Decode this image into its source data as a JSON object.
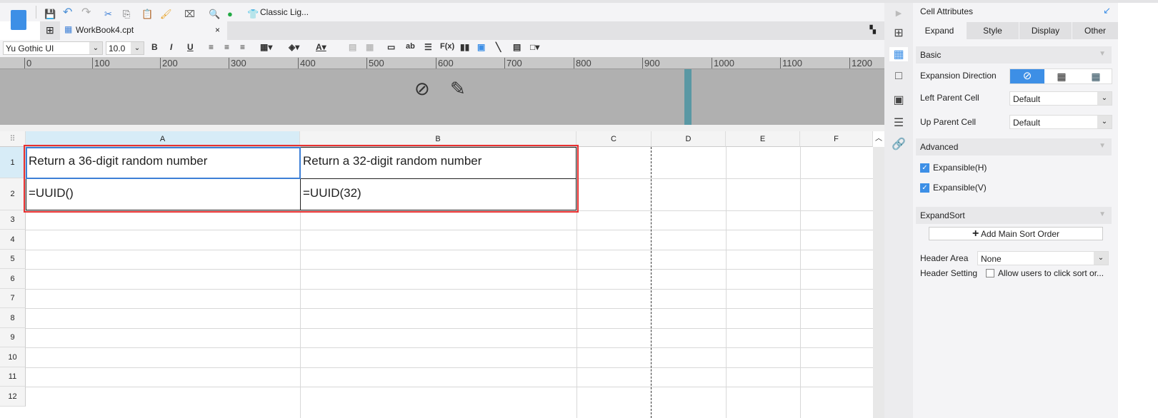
{
  "toolbar": {
    "theme_label": "Classic Lig..."
  },
  "tab": {
    "label": "WorkBook4.cpt",
    "close": "×"
  },
  "format": {
    "font": "Yu Gothic UI",
    "size": "10.0",
    "bold": "B",
    "italic": "I",
    "underline": "U",
    "text_abc": "ab",
    "fx": "F(x)"
  },
  "ruler": {
    "ticks": [
      "0",
      "100",
      "200",
      "300",
      "400",
      "500",
      "600",
      "700",
      "800",
      "900",
      "1000",
      "1100",
      "1200"
    ]
  },
  "grid": {
    "columns": [
      "A",
      "B",
      "C",
      "D",
      "E",
      "F"
    ],
    "rows": [
      "1",
      "2",
      "3",
      "4",
      "5",
      "6",
      "7",
      "8",
      "9",
      "10",
      "11",
      "12"
    ],
    "cells": {
      "A1": "Return a 36-digit random number",
      "B1": "Return a 32-digit random number",
      "A2": "=UUID()",
      "B2": "=UUID(32)"
    }
  },
  "panel": {
    "title": "Cell Attributes",
    "tabs": [
      "Expand",
      "Style",
      "Display",
      "Other"
    ],
    "basic": "Basic",
    "expansion_direction": "Expansion Direction",
    "left_parent": "Left Parent Cell",
    "left_parent_value": "Default",
    "up_parent": "Up Parent Cell",
    "up_parent_value": "Default",
    "advanced": "Advanced",
    "expansible_h": "Expansible(H)",
    "expansible_v": "Expansible(V)",
    "expandsort": "ExpandSort",
    "add_sort": "Add Main Sort Order",
    "header_area": "Header Area",
    "header_area_value": "None",
    "header_setting": "Header Setting",
    "allow_sort": "Allow users to click sort or..."
  },
  "colors": {
    "accent": "#3d8fe6",
    "selection": "#e83030"
  }
}
